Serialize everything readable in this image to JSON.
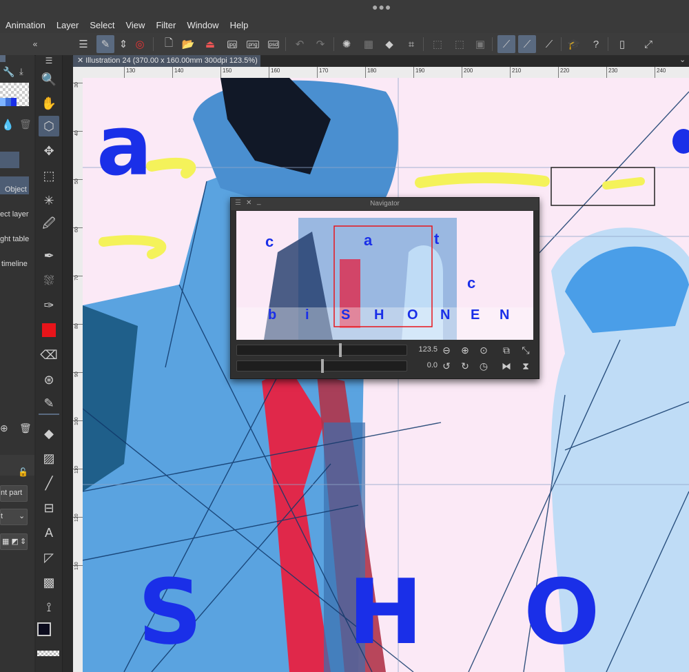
{
  "menu": [
    "Animation",
    "Layer",
    "Select",
    "View",
    "Filter",
    "Window",
    "Help"
  ],
  "toolbar": {
    "jpg_label": "jpg",
    "png_label": "png",
    "psd_label": "psd"
  },
  "left_panel": {
    "object_label": "Object",
    "items": [
      "ect layer",
      "ght table",
      "timeline"
    ],
    "dropdown1": "nt part",
    "dropdown2": "t"
  },
  "document": {
    "tab_title": "Illustration 24 (370.00 x 160.00mm 300dpi 123.5%)"
  },
  "ruler": {
    "h_labels": [
      "130",
      "140",
      "150",
      "160",
      "170",
      "180",
      "190",
      "200",
      "210",
      "220",
      "230",
      "240"
    ],
    "v_labels": [
      "30",
      "40",
      "50",
      "60",
      "70",
      "80",
      "90",
      "100",
      "110",
      "120",
      "130"
    ]
  },
  "navigator": {
    "title": "Navigator",
    "zoom": "123.5",
    "rotation": "0.0"
  },
  "canvas_text": {
    "a": "a",
    "s": "S",
    "h": "H",
    "o": "O"
  },
  "thumbnail_text": {
    "top": [
      "c",
      "a",
      "t"
    ],
    "bottom": [
      "b",
      "i",
      "S",
      "H",
      "O",
      "N",
      "E",
      "N"
    ],
    "c2": "c"
  },
  "colors": {
    "accent": "#5a6a80",
    "blue": "#1a2fe8",
    "yellow": "#f4f25a",
    "canvas_bg": "#fbe9f6",
    "red_swatch": "#e8141a"
  }
}
